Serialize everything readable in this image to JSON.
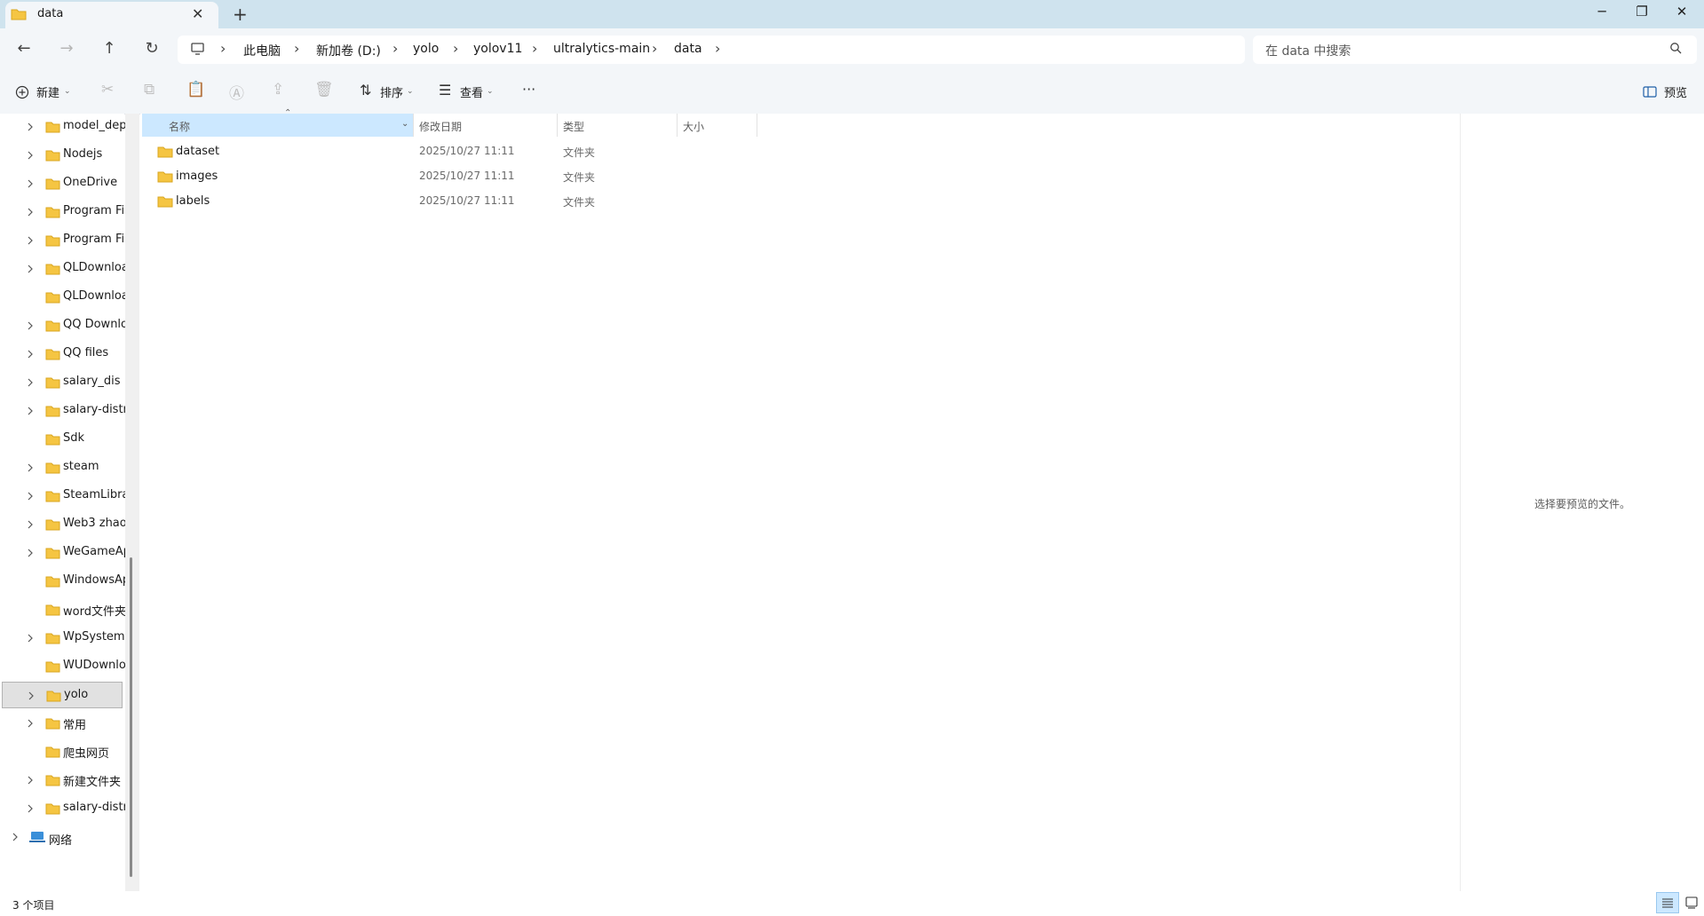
{
  "window": {
    "tab_title": "data",
    "tab_close": "✕",
    "new_tab": "+",
    "minimize": "─",
    "restore": "❐",
    "close": "✕"
  },
  "nav": {
    "back": "←",
    "forward": "→",
    "up": "↑",
    "refresh": "↻"
  },
  "breadcrumb": [
    "此电脑",
    "新加卷 (D:)",
    "yolo",
    "yolov11",
    "ultralytics-main",
    "data"
  ],
  "search": {
    "placeholder": "在 data 中搜索"
  },
  "toolbar": {
    "new_label": "新建",
    "sort_label": "排序",
    "view_label": "查看",
    "more": "···",
    "preview_label": "预览"
  },
  "sidebar": {
    "items": [
      {
        "label": "model_dep",
        "expandable": true
      },
      {
        "label": "Nodejs",
        "expandable": true
      },
      {
        "label": "OneDrive",
        "expandable": true
      },
      {
        "label": "Program Fil",
        "expandable": true
      },
      {
        "label": "Program Fil",
        "expandable": true
      },
      {
        "label": "QLDownloa",
        "expandable": true
      },
      {
        "label": "QLDownloa",
        "expandable": false
      },
      {
        "label": "QQ Downlo",
        "expandable": true
      },
      {
        "label": "QQ files",
        "expandable": true
      },
      {
        "label": "salary_dis",
        "expandable": true
      },
      {
        "label": "salary-distri",
        "expandable": true
      },
      {
        "label": "Sdk",
        "expandable": false
      },
      {
        "label": "steam",
        "expandable": true
      },
      {
        "label": "SteamLibrar",
        "expandable": true
      },
      {
        "label": "Web3 zhao",
        "expandable": true
      },
      {
        "label": "WeGameAp",
        "expandable": true
      },
      {
        "label": "WindowsAp",
        "expandable": false
      },
      {
        "label": "word文件夹",
        "expandable": false
      },
      {
        "label": "WpSystem",
        "expandable": true
      },
      {
        "label": "WUDownloa",
        "expandable": false
      },
      {
        "label": "yolo",
        "expandable": true,
        "selected": true
      },
      {
        "label": "常用",
        "expandable": true
      },
      {
        "label": "爬虫网页",
        "expandable": false
      },
      {
        "label": "新建文件夹",
        "expandable": true
      },
      {
        "label": "salary-distri",
        "expandable": true
      }
    ],
    "network_label": "网络"
  },
  "columns": {
    "name": "名称",
    "modified": "修改日期",
    "type": "类型",
    "size": "大小"
  },
  "files": [
    {
      "name": "dataset",
      "modified": "2025/10/27 11:11",
      "type": "文件夹"
    },
    {
      "name": "images",
      "modified": "2025/10/27 11:11",
      "type": "文件夹"
    },
    {
      "name": "labels",
      "modified": "2025/10/27 11:11",
      "type": "文件夹"
    }
  ],
  "preview": {
    "empty_text": "选择要预览的文件。"
  },
  "status": {
    "item_count": "3 个项目"
  },
  "colors": {
    "accent": "#cce8ff",
    "folder": "#f5c542",
    "titlebar": "#cfe3ee"
  }
}
